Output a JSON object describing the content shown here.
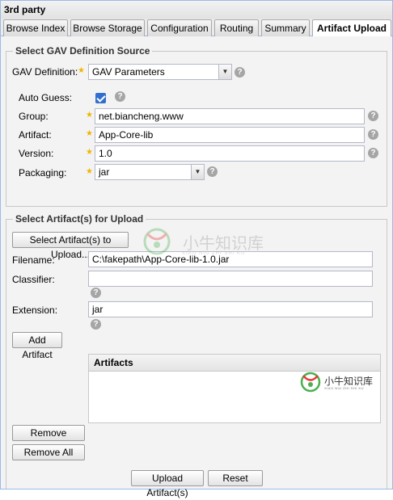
{
  "panel": {
    "title": "3rd party"
  },
  "tabs": [
    {
      "label": "Browse Index"
    },
    {
      "label": "Browse Storage"
    },
    {
      "label": "Configuration"
    },
    {
      "label": "Routing"
    },
    {
      "label": "Summary"
    },
    {
      "label": "Artifact Upload",
      "active": true
    }
  ],
  "gav_section": {
    "legend": "Select GAV Definition Source",
    "definition_label": "GAV Definition:",
    "definition_value": "GAV Parameters",
    "auto_guess_label": "Auto Guess:",
    "auto_guess_checked": true,
    "group_label": "Group:",
    "group_value": "net.biancheng.www",
    "artifact_label": "Artifact:",
    "artifact_value": "App-Core-lib",
    "version_label": "Version:",
    "version_value": "1.0",
    "packaging_label": "Packaging:",
    "packaging_value": "jar"
  },
  "artifact_section": {
    "legend": "Select Artifact(s) for Upload",
    "select_button": "Select Artifact(s) to Upload...",
    "filename_label": "Filename:",
    "filename_value": "C:\\fakepath\\App-Core-lib-1.0.jar",
    "classifier_label": "Classifier:",
    "classifier_value": "",
    "extension_label": "Extension:",
    "extension_value": "jar",
    "add_button": "Add Artifact",
    "grid_header": "Artifacts",
    "remove_button": "Remove",
    "remove_all_button": "Remove All"
  },
  "footer": {
    "upload_button": "Upload Artifact(s)",
    "reset_button": "Reset"
  },
  "watermark": {
    "text": "小牛知识库",
    "subtext": "XIAO NIU ZHI SHI KU",
    "colors": {
      "green": "#4caf50",
      "red": "#e53935"
    }
  },
  "colors": {
    "accent_border": "#99bbe8",
    "required_star": "#f0b400",
    "checkbox": "#2f6fd1"
  }
}
